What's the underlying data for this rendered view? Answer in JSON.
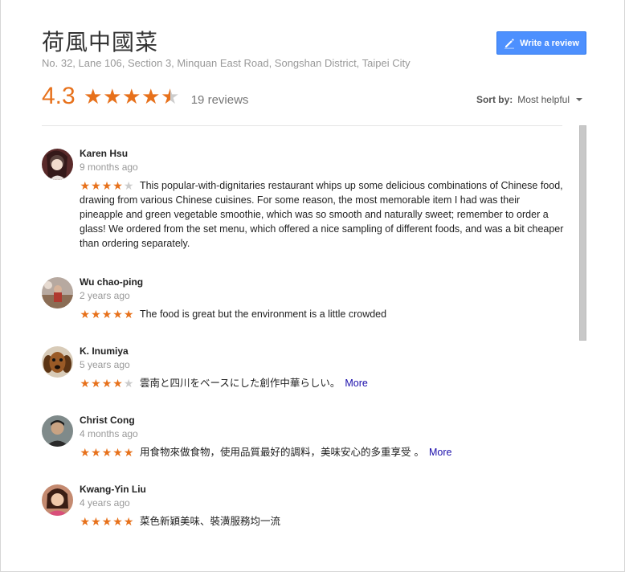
{
  "place": {
    "name": "荷風中國菜",
    "address": "No. 32, Lane 106, Section 3, Minquan East Road, Songshan District, Taipei City"
  },
  "write_review": {
    "label": "Write a review",
    "icon": "pencil-icon"
  },
  "summary": {
    "score": "4.3",
    "rating_value": 4.3,
    "reviews_label": "19 reviews"
  },
  "sort": {
    "label": "Sort by:",
    "value": "Most helpful"
  },
  "colors": {
    "accent": "#e7711b",
    "button": "#4d90fe",
    "link": "#1a0dab"
  },
  "reviews": [
    {
      "name": "Karen Hsu",
      "time": "9 months ago",
      "rating": 4,
      "text": "This popular-with-dignitaries restaurant whips up some delicious combinations of Chinese food, drawing from various Chinese cuisines. For some reason, the most memorable item I had was their pineapple and green vegetable smoothie, which was so smooth and naturally sweet; remember to order a glass! We ordered from the set menu, which offered a nice sampling of different foods, and was a bit cheaper than ordering separately.",
      "more": ""
    },
    {
      "name": "Wu chao-ping",
      "time": "2 years ago",
      "rating": 5,
      "text": "The food is great but the environment is a little crowded",
      "more": ""
    },
    {
      "name": "K. Inumiya",
      "time": "5 years ago",
      "rating": 4,
      "text": "雲南と四川をベースにした創作中華らしい。",
      "more": "More"
    },
    {
      "name": "Christ Cong",
      "time": "4 months ago",
      "rating": 5,
      "text": "用食物來做食物，使用品質最好的調料，美味安心的多重享受 。",
      "more": "More"
    },
    {
      "name": "Kwang-Yin Liu",
      "time": "4 years ago",
      "rating": 5,
      "text": "菜色新穎美味、裝潢服務均一流",
      "more": ""
    }
  ]
}
